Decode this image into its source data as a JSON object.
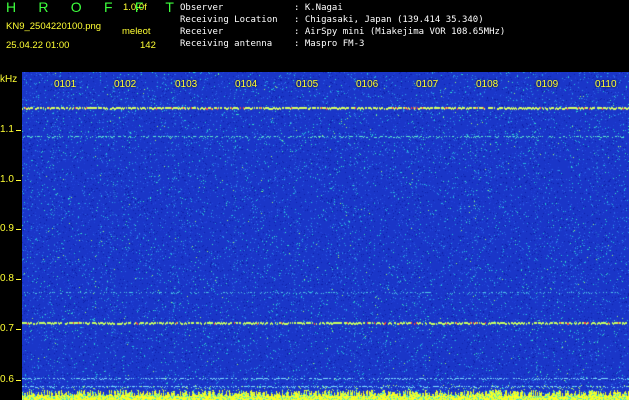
{
  "header": {
    "title": "H R O F F T",
    "version": "1.0.0f",
    "filename": "KN9_2504220100.png",
    "ml_label": "meleot",
    "datetime": "25.04.22 01:00",
    "count": "142",
    "info": [
      {
        "label": "Observer",
        "value": ": K.Nagai"
      },
      {
        "label": "Receiving Location",
        "value": ": Chigasaki, Japan (139.414 35.340)"
      },
      {
        "label": "Receiver",
        "value": ": AirSpy mini (Miakejima VOR 108.65MHz)"
      },
      {
        "label": "Receiving antenna",
        "value": ": Maspro FM-3"
      }
    ]
  },
  "spectrogram": {
    "y_unit": "kHz",
    "y_labels": [
      "1.1",
      "1.0",
      "0.9",
      "0.8",
      "0.7",
      "0.6"
    ],
    "y_range": [
      0.57,
      1.155
    ],
    "x_labels": [
      "0101",
      "0102",
      "0103",
      "0104",
      "0105",
      "0106",
      "0107",
      "0108",
      "0109",
      "0110"
    ],
    "lines_khz": [
      1.092,
      1.04,
      0.762,
      0.71,
      0.61,
      0.595
    ],
    "colors": {
      "background": "#1a36c8",
      "noise_high": "#1fe0e0",
      "carrier": "#e8ff60",
      "label": "#ffff33",
      "title": "#3dff3d"
    }
  }
}
